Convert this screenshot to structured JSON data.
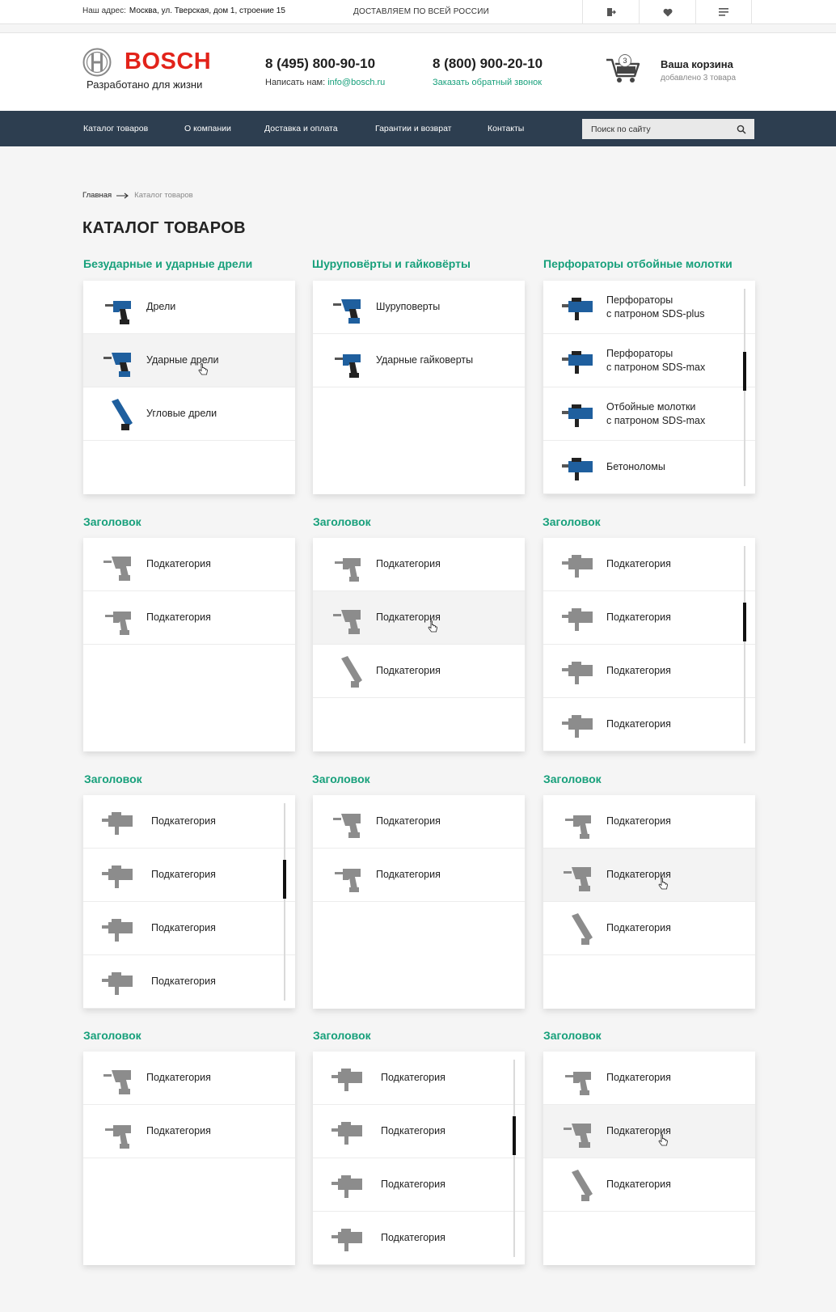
{
  "topbar": {
    "address_label": "Наш адрес:",
    "address_value": "Москва, ул. Тверская, дом 1, строение 15",
    "delivery": "ДОСТАВЛЯЕМ ПО ВСЕЙ РОССИИ",
    "icons": [
      "login-icon",
      "heart-icon",
      "menu-icon"
    ]
  },
  "header": {
    "brand": "BOSCH",
    "tagline": "Разработано для жизни",
    "phone1": "8 (495) 800-90-10",
    "write_label": "Написать нам:",
    "email": "info@bosch.ru",
    "phone2": "8 (800) 900-20-10",
    "callback": "Заказать обратный звонок",
    "cart_count": "3",
    "cart_title": "Ваша корзина",
    "cart_sub": "добавлено 3 товара"
  },
  "nav": {
    "items": [
      "Каталог товаров",
      "О компании",
      "Доставка и оплата",
      "Гарантии и возврат",
      "Контакты"
    ],
    "search_placeholder": "Поиск по сайту"
  },
  "breadcrumbs": {
    "home": "Главная",
    "current": "Каталог товаров"
  },
  "page_title": "КАТАЛОГ ТОВАРОВ",
  "colors": {
    "accent": "#17a07b",
    "brand": "#e2231a",
    "nav_bg": "#2d3e50"
  },
  "categories": [
    {
      "title": "Безударные и ударные дрели",
      "items": [
        "Дрели",
        "Ударные дрели",
        "Угловые дрели"
      ]
    },
    {
      "title": "Шуруповёрты и гайковёрты",
      "items": [
        "Шуруповерты",
        "Ударные гайковерты"
      ]
    },
    {
      "title": "Перфораторы отбойные молотки",
      "items": [
        "Перфораторы\nс патроном SDS-plus",
        "Перфораторы\nс патроном SDS-max",
        "Отбойные молотки\nс патроном SDS-max",
        "Бетоноломы"
      ]
    },
    {
      "title": "Заголовок",
      "items": [
        "Подкатегория",
        "Подкатегория"
      ]
    },
    {
      "title": "Заголовок",
      "items": [
        "Подкатегория",
        "Подкатегория",
        "Подкатегория"
      ]
    },
    {
      "title": "Заголовок",
      "items": [
        "Подкатегория",
        "Подкатегория",
        "Подкатегория",
        "Подкатегория"
      ]
    },
    {
      "title": "Заголовок",
      "items": [
        "Подкатегория",
        "Подкатегория",
        "Подкатегория",
        "Подкатегория"
      ]
    },
    {
      "title": "Заголовок",
      "items": [
        "Подкатегория",
        "Подкатегория"
      ]
    },
    {
      "title": "Заголовок",
      "items": [
        "Подкатегория",
        "Подкатегория",
        "Подкатегория"
      ]
    },
    {
      "title": "Заголовок",
      "items": [
        "Подкатегория",
        "Подкатегория"
      ]
    },
    {
      "title": "Заголовок",
      "items": [
        "Подкатегория",
        "Подкатегория",
        "Подкатегория",
        "Подкатегория"
      ]
    },
    {
      "title": "Заголовок",
      "items": [
        "Подкатегория",
        "Подкатегория",
        "Подкатегория"
      ]
    }
  ]
}
